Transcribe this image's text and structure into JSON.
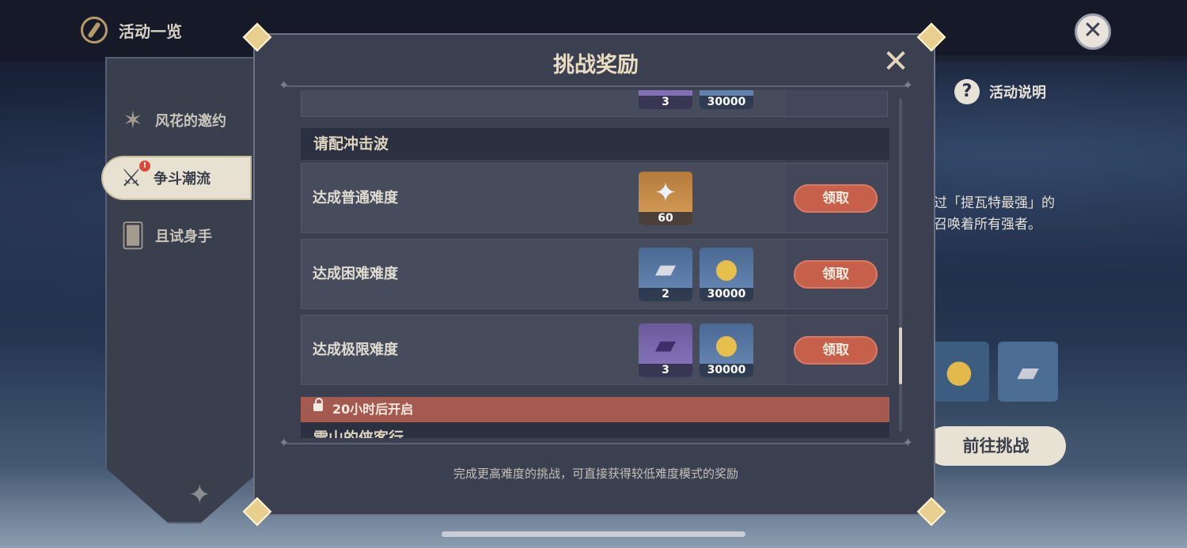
{
  "top_bar": {
    "title": "活动一览"
  },
  "side_menu": {
    "items": [
      {
        "label": "风花的邀约",
        "icon": "flower-star-icon"
      },
      {
        "label": "争斗潮流",
        "icon": "fighter-icon",
        "alert": "!"
      },
      {
        "label": "且试身手",
        "icon": "cards-icon"
      }
    ]
  },
  "background": {
    "help_label": "活动说明",
    "help_icon": "?",
    "desc_line1": "过「提瓦特最强」的",
    "desc_line2": "召唤着所有强者。",
    "go_button": "前往挑战"
  },
  "modal": {
    "title": "挑战奖励",
    "footer_note": "完成更高难度的挑战，可直接获得较低难度模式的奖励",
    "previous_row": {
      "rewards": [
        {
          "count": "3",
          "icon": "purple-book-icon",
          "rarity": "purple"
        },
        {
          "count": "30000",
          "icon": "mora-coin-icon",
          "rarity": "blue"
        }
      ]
    },
    "group": {
      "title": "请配冲击波",
      "rows": [
        {
          "label": "达成普通难度",
          "button": "领取",
          "rewards": [
            {
              "count": "60",
              "icon": "primogem-icon",
              "rarity": "gold"
            }
          ]
        },
        {
          "label": "达成困难难度",
          "button": "领取",
          "rewards": [
            {
              "count": "2",
              "icon": "silver-book-icon",
              "rarity": "blue"
            },
            {
              "count": "30000",
              "icon": "mora-coin-icon",
              "rarity": "blue"
            }
          ]
        },
        {
          "label": "达成极限难度",
          "button": "领取",
          "rewards": [
            {
              "count": "3",
              "icon": "purple-book-icon",
              "rarity": "purple"
            },
            {
              "count": "30000",
              "icon": "mora-coin-icon",
              "rarity": "blue"
            }
          ]
        }
      ]
    },
    "locked_group": {
      "lock_text": "20小时后开启",
      "title": "雪山的侠客行"
    }
  },
  "colors": {
    "claim_button": "#c7604b",
    "locked_bar": "#a45a4e",
    "panel": "#3b4050",
    "title_gold": "#e8dcc1"
  }
}
